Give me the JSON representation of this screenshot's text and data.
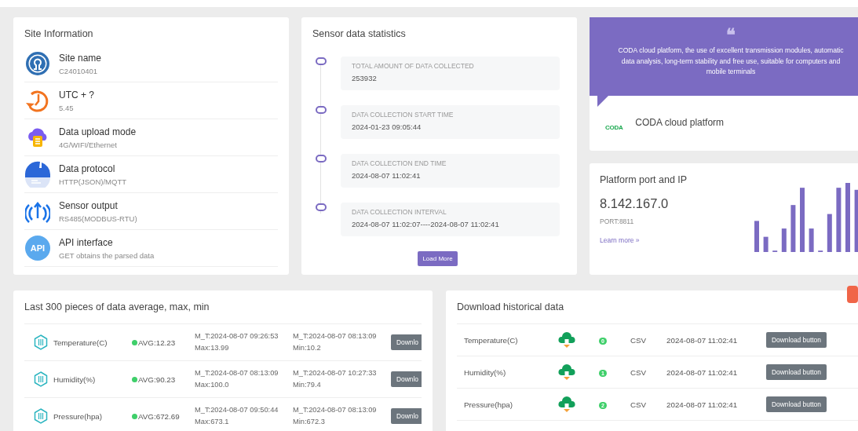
{
  "site_info": {
    "title": "Site Information",
    "items": [
      {
        "kind": "site",
        "label": "Site name",
        "value": "C24010401"
      },
      {
        "kind": "utc",
        "label": "UTC + ?",
        "value": "5.45"
      },
      {
        "kind": "upload",
        "label": "Data upload mode",
        "value": "4G/WIFI/Ethernet"
      },
      {
        "kind": "protocol",
        "label": "Data protocol",
        "value": "HTTP(JSON)/MQTT"
      },
      {
        "kind": "output",
        "label": "Sensor output",
        "value": "RS485(MODBUS-RTU)"
      },
      {
        "kind": "api",
        "label": "API interface",
        "value": "GET obtains the parsed data",
        "icon_text": "API"
      }
    ]
  },
  "statistics": {
    "title": "Sensor data statistics",
    "items": [
      {
        "label": "TOTAL AMOUNT OF DATA COLLECTED",
        "value": "253932"
      },
      {
        "label": "DATA COLLECTION START TIME",
        "value": "2024-01-23 09:05:44"
      },
      {
        "label": "DATA COLLECTION END TIME",
        "value": "2024-08-07 11:02:41"
      },
      {
        "label": "DATA COLLECTION INTERVAL",
        "value": "2024-08-07 11:02:07----2024-08-07 11:02:41"
      }
    ],
    "button": "Load More"
  },
  "testimonial": {
    "quote_mark": "❝",
    "text": "CODA cloud platform, the use of excellent transmission modules, automatic data analysis, long-term stability and free use, suitable for computers and mobile terminals",
    "logo": "CODA",
    "name": "CODA cloud platform"
  },
  "platform": {
    "title": "Platform port and IP",
    "ip": "8.142.167.0",
    "port": "PORT:8811",
    "link": "Learn more »"
  },
  "averages": {
    "title": "Last 300 pieces of data average, max, min",
    "rows": [
      {
        "name": "Temperature(C)",
        "avg": "AVG:12.23",
        "max_time": "M_T:2024-08-07 09:26:53",
        "max": "Max:13.99",
        "min_time": "M_T:2024-08-07 08:13:09",
        "min": "Min:10.2",
        "button": "Downlo"
      },
      {
        "name": "Humidity(%)",
        "avg": "AVG:90.23",
        "max_time": "M_T:2024-08-07 08:13:09",
        "max": "Max:100.0",
        "min_time": "M_T:2024-08-07 10:27:33",
        "min": "Min:79.4",
        "button": "Downlo"
      },
      {
        "name": "Pressure(hpa)",
        "avg": "AVG:672.69",
        "max_time": "M_T:2024-08-07 09:50:44",
        "max": "Max:673.1",
        "min_time": "M_T:2024-08-07 08:13:09",
        "min": "Min:672.3",
        "button": "Downlo"
      }
    ]
  },
  "downloads": {
    "title": "Download historical data",
    "rows": [
      {
        "name": "Temperature(C)",
        "index": "0",
        "format": "CSV",
        "time": "2024-08-07 11:02:41",
        "button": "Download button"
      },
      {
        "name": "Humidity(%)",
        "index": "1",
        "format": "CSV",
        "time": "2024-08-07 11:02:41",
        "button": "Download button"
      },
      {
        "name": "Pressure(hpa)",
        "index": "2",
        "format": "CSV",
        "time": "2024-08-07 11:02:41",
        "button": "Download button"
      }
    ]
  }
}
